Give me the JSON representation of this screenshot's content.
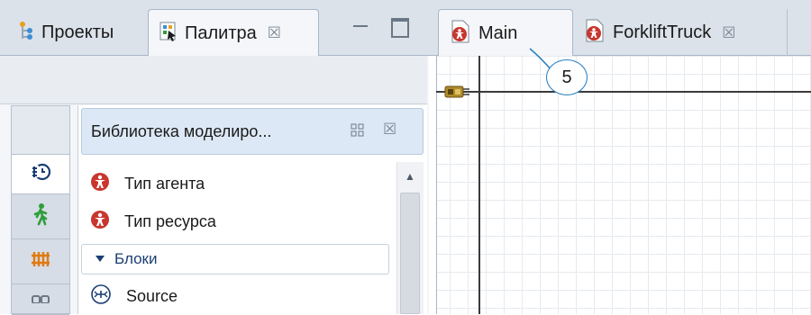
{
  "left_panel": {
    "tabs": [
      {
        "label": "Проекты",
        "icon": "projects-icon",
        "active": false
      },
      {
        "label": "Палитра",
        "icon": "palette-icon",
        "active": true,
        "close_glyph": "☒"
      }
    ],
    "window_buttons": [
      "minimize-icon",
      "maximize-icon"
    ]
  },
  "palette": {
    "categories": [
      "empty",
      "process-modeling-icon",
      "pedestrian-icon",
      "rail-icon",
      "more-icon"
    ],
    "library": {
      "title": "Библиотека моделиро...",
      "close_glyph": "☒",
      "items": [
        {
          "label": "Тип агента",
          "icon": "agent-type-icon"
        },
        {
          "label": "Тип ресурса",
          "icon": "resource-type-icon"
        }
      ],
      "section": {
        "label": "Блоки",
        "expanded": true
      },
      "block_items": [
        {
          "label": "Source",
          "icon": "source-icon"
        }
      ]
    }
  },
  "editor": {
    "tabs": [
      {
        "label": "Main",
        "icon": "agent-type-icon",
        "active": true
      },
      {
        "label": "ForkliftTruck",
        "icon": "agent-type-icon",
        "active": false,
        "close_glyph": "☒"
      }
    ]
  },
  "callout": {
    "number": "5"
  },
  "colors": {
    "accent_blue": "#2a7fc1",
    "agent_red": "#c8362e",
    "pedestrian_green": "#2f9e3a",
    "rail_orange": "#e07a12",
    "section_text": "#1b3f73"
  }
}
